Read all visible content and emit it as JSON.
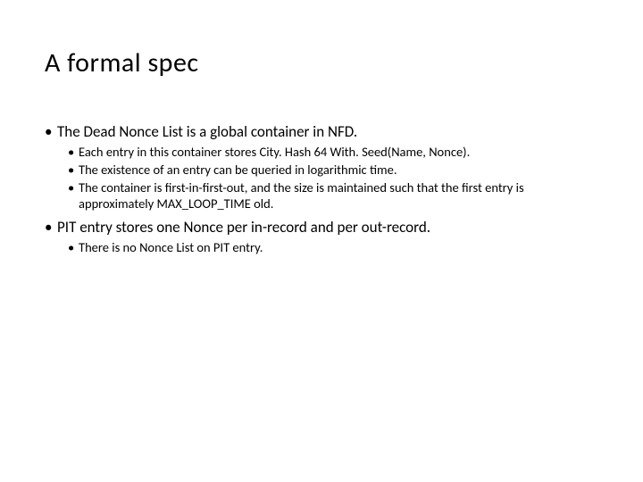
{
  "title": "A formal spec",
  "b1": "The Dead Nonce List is a global container in NFD.",
  "b1s1": "Each entry in this container stores City. Hash 64 With. Seed(Name, Nonce).",
  "b1s2": "The existence of an entry can be queried in logarithmic time.",
  "b1s3": "The container is first-in-first-out, and the size is maintained such that the first entry is approximately MAX_LOOP_TIME old.",
  "b2": "PIT entry stores one Nonce per in-record and per out-record.",
  "b2s1": "There is no Nonce List on PIT entry."
}
